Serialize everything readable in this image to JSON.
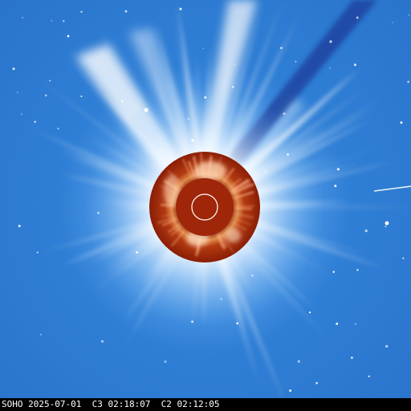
{
  "caption": "SOHO 2025-07-01  C3 02:18:07  C2 02:12:05",
  "colors": {
    "c3_background": "#2f7fd6",
    "c3_corona": "#ffffff",
    "c2_outer": "#9a2208",
    "c2_inner": "#e07a40",
    "occulter": "#a52a0a",
    "sun_outline": "#ffffff"
  }
}
